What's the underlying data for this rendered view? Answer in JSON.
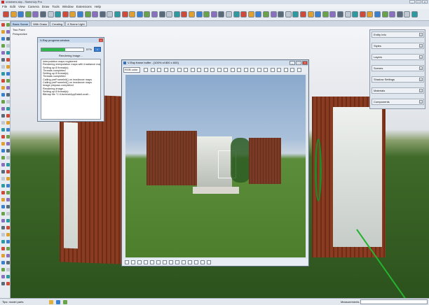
{
  "titlebar": {
    "title": "ontainers.skp - SketchUp Pro",
    "window_buttons": [
      "_",
      "□",
      "×"
    ]
  },
  "menubar": {
    "items": [
      "File",
      "Edit",
      "View",
      "Camera",
      "Draw",
      "Tools",
      "Window",
      "Extensions",
      "Help"
    ]
  },
  "scene_tabs": [
    "Basic Scene",
    "With Grass",
    "Creating",
    "4 Scene Light"
  ],
  "viewport": {
    "camera_label": "Two Point",
    "projection_label": "Perspective"
  },
  "right_panels": [
    {
      "label": "Entity Info"
    },
    {
      "label": "Styles"
    },
    {
      "label": "Layers"
    },
    {
      "label": "Scenes"
    },
    {
      "label": "Shadow Settings"
    },
    {
      "label": "Materials"
    },
    {
      "label": "Components"
    }
  ],
  "progress_window": {
    "title": "V-Ray progress window",
    "percent": "57%",
    "progress_fraction": 0.57,
    "cancel_label": "×",
    "status": "Rendering image...",
    "log": [
      "Interpolation maps registered",
      "Rendering interpolation maps with irradiance map",
      "Setting up 8 thread(s)",
      "Threads completed",
      "Setting up 8 thread(s)",
      "Threads completed",
      "Calling preFrameInit() on irradiance maps",
      "Calling preFrameInit() on irradiance maps",
      "Image prepass completed",
      "Rendering image...",
      "Setting up 8 thread(s)",
      "Bitmap file \"C:\\Users\\a\\AppData\\Local\\..."
    ]
  },
  "vfb": {
    "title": "V-Ray frame buffer - [100% of 800 x 600]",
    "channel": "RGB color",
    "window_buttons": [
      "_",
      "□",
      "×"
    ]
  },
  "statusbar": {
    "hint_text": "Tips: model parts",
    "measurements_label": "Measurements"
  },
  "colors": {
    "container_rust": "#8b3b20",
    "grass": "#3f6a2a",
    "axis_green": "#24b32e",
    "progress_green": "#2fb84a"
  }
}
